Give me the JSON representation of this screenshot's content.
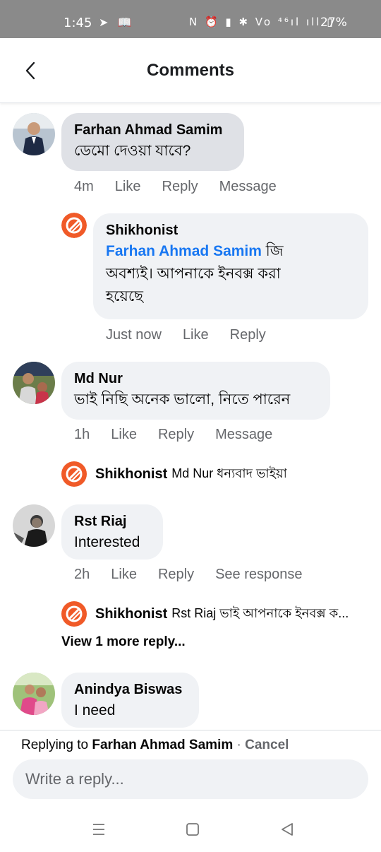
{
  "status_bar": {
    "time": "1:45",
    "battery": "27%",
    "left_icons": "➤ 📖",
    "right_icons": "N ⏰ ▮ ✱ Vo ⁴⁶ıl ıll ▯"
  },
  "header": {
    "title": "Comments"
  },
  "comments": [
    {
      "author": "Farhan Ahmad Samim",
      "text": "ডেমো দেওয়া যাবে?",
      "time": "4m",
      "actions": [
        "Like",
        "Reply",
        "Message"
      ]
    },
    {
      "author": "Md Nur",
      "text": "ভাই নিছি অনেক ভালো, নিতে পারেন",
      "time": "1h",
      "actions": [
        "Like",
        "Reply",
        "Message"
      ]
    },
    {
      "author": "Rst Riaj",
      "text": "Interested",
      "time": "2h",
      "actions": [
        "Like",
        "Reply",
        "See response"
      ]
    },
    {
      "author": "Anindya Biswas",
      "text": "I need"
    }
  ],
  "reply_1": {
    "author": "Shikhonist",
    "mention": "Farhan Ahmad Samim",
    "text_line1": " জি",
    "text_line2": "অবশ্যই। আপনাকে ইনবক্স করা",
    "text_line3": "হয়েছে",
    "time": "Just now",
    "actions": [
      "Like",
      "Reply"
    ]
  },
  "reply_2": {
    "author": "Shikhonist",
    "text": "Md Nur ধন্যবাদ ভাইয়া"
  },
  "reply_3": {
    "author": "Shikhonist",
    "text": "Rst Riaj ভাই আপনাকে ইনবক্স ক..."
  },
  "more_replies": "View 1 more reply...",
  "composer": {
    "replying_prefix": "Replying to ",
    "replying_name": "Farhan Ahmad Samim",
    "separator": " · ",
    "cancel": "Cancel",
    "placeholder": "Write a reply..."
  },
  "colors": {
    "mention": "#1877f2",
    "page_logo": "#f05a28",
    "bubble": "#f0f2f5"
  },
  "icons": {
    "back": "chevron-left-icon",
    "page_logo": "shikhonist-logo",
    "nav_recents": "recents-icon",
    "nav_home": "home-icon",
    "nav_back": "back-triangle-icon"
  }
}
